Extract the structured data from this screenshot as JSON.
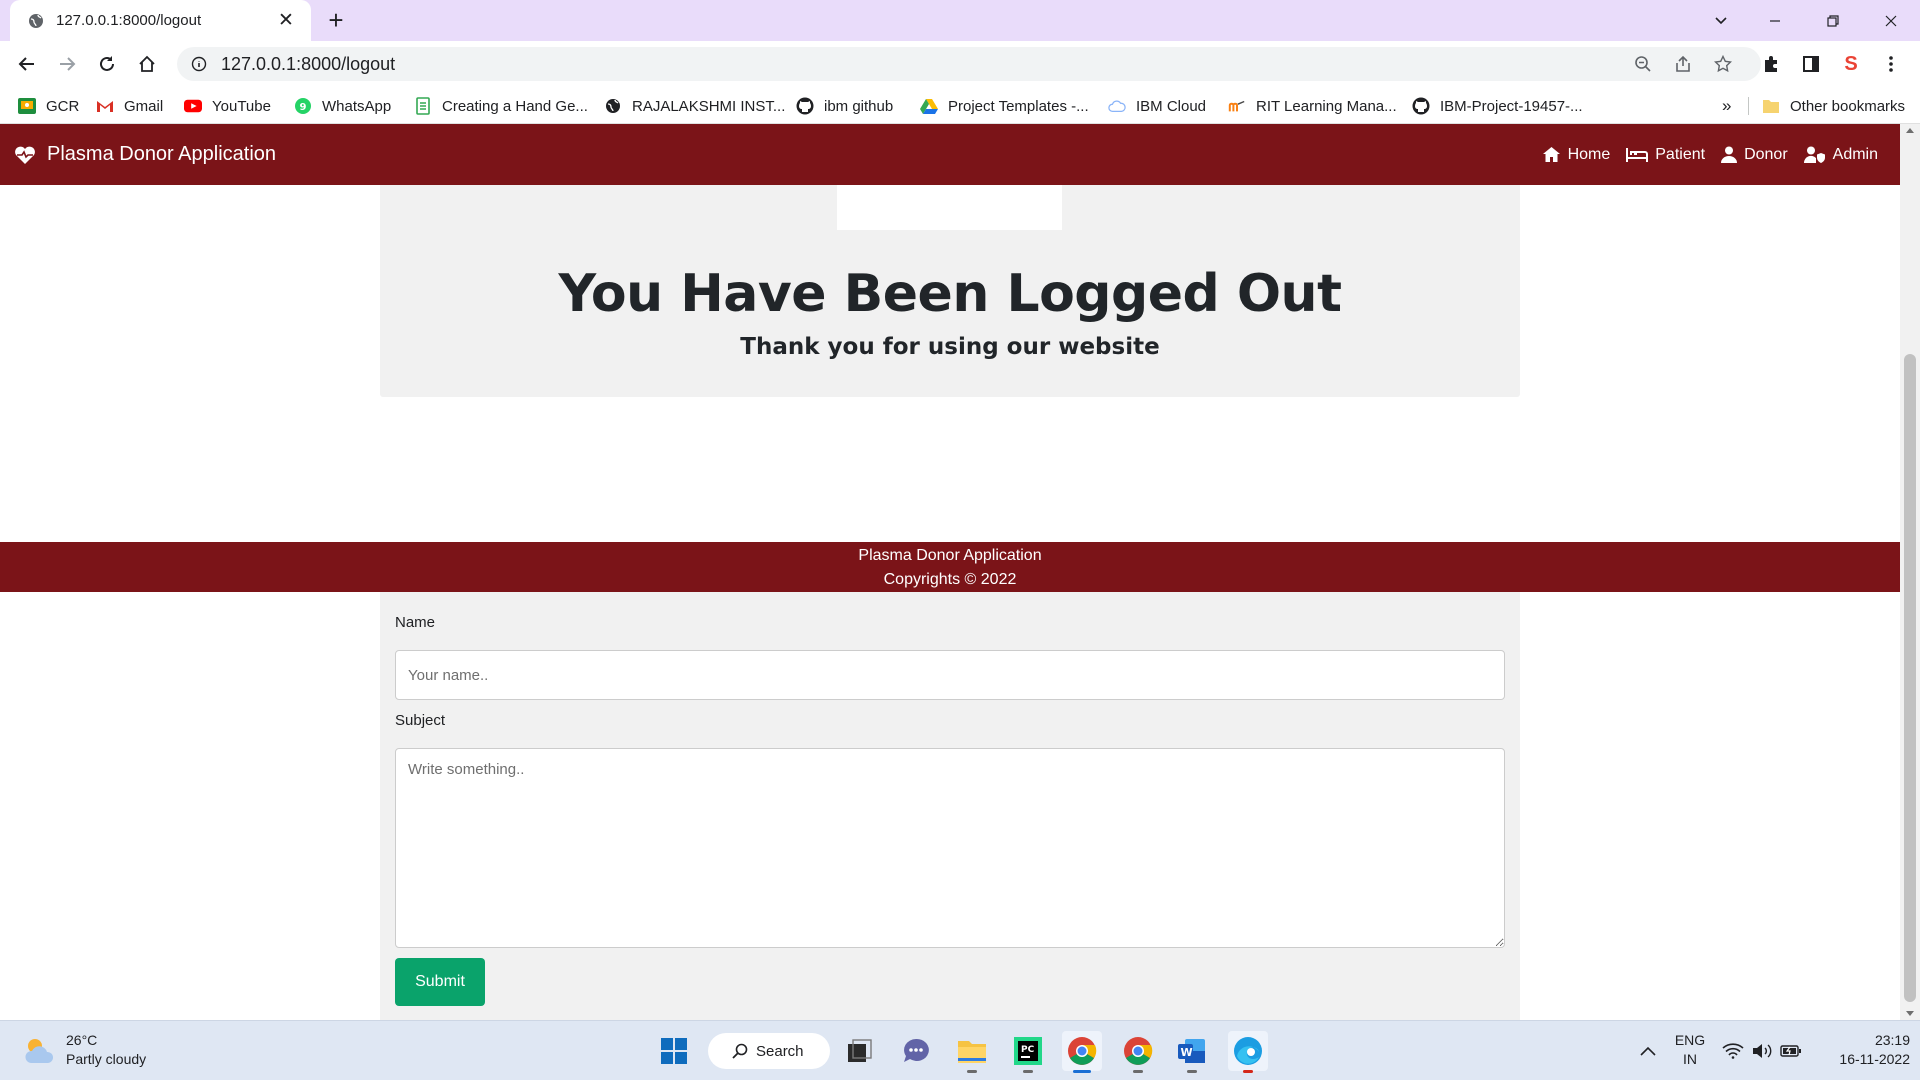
{
  "browser": {
    "tab_title": "127.0.0.1:8000/logout",
    "url": "127.0.0.1:8000/logout",
    "bookmarks": [
      {
        "label": "GCR",
        "icon": "google-classroom-icon",
        "color": "#1e8e3e"
      },
      {
        "label": "Gmail",
        "icon": "gmail-icon",
        "color": "#d93025"
      },
      {
        "label": "YouTube",
        "icon": "youtube-icon",
        "color": "#ff0000"
      },
      {
        "label": "WhatsApp",
        "icon": "whatsapp-icon",
        "color": "#25d366"
      },
      {
        "label": "Creating a Hand Ge...",
        "icon": "document-icon",
        "color": "#34a853"
      },
      {
        "label": "RAJALAKSHMI INST...",
        "icon": "globe-icon",
        "color": "#202124"
      },
      {
        "label": "ibm github",
        "icon": "github-icon",
        "color": "#202124"
      },
      {
        "label": "Project Templates -...",
        "icon": "google-drive-icon",
        "color": "#1a73e8"
      },
      {
        "label": "IBM Cloud",
        "icon": "cloud-icon",
        "color": "#8ab4f8"
      },
      {
        "label": "RIT Learning Mana...",
        "icon": "moodle-icon",
        "color": "#f98012"
      },
      {
        "label": "IBM-Project-19457-...",
        "icon": "github-icon",
        "color": "#202124"
      }
    ],
    "more_bookmarks": "»",
    "other_bookmarks": "Other bookmarks"
  },
  "site": {
    "brand": "Plasma Donor Application",
    "nav": [
      {
        "label": "Home",
        "icon": "home-icon"
      },
      {
        "label": "Patient",
        "icon": "bed-icon"
      },
      {
        "label": "Donor",
        "icon": "user-icon"
      },
      {
        "label": "Admin",
        "icon": "user-shield-icon"
      }
    ],
    "accent_color": "#7b1418"
  },
  "logout": {
    "title": "You Have Been Logged Out",
    "subtitle": "Thank you for using our website"
  },
  "footer": {
    "line1": "Plasma Donor Application",
    "line2": "Copyrights © 2022"
  },
  "contact_form": {
    "name_label": "Name",
    "name_placeholder": "Your name..",
    "subject_label": "Subject",
    "subject_placeholder": "Write something..",
    "submit_label": "Submit",
    "submit_color": "#0aa36b"
  },
  "taskbar": {
    "weather_temp": "26°C",
    "weather_desc": "Partly cloudy",
    "search_label": "Search",
    "lang_line1": "ENG",
    "lang_line2": "IN",
    "time": "23:19",
    "date": "16-11-2022"
  }
}
